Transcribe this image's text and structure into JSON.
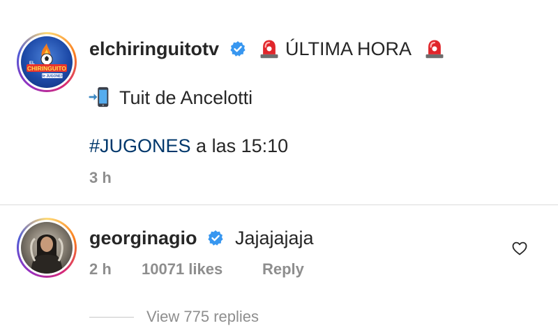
{
  "post": {
    "username": "elchiringuitotv",
    "headline": "ÚLTIMA HORA",
    "line2_text": "Tuit de Ancelotti",
    "hashtag": "#JUGONES",
    "hashtag_suffix": " a las 15:10",
    "time": "3 h",
    "avatar_logo_text": "CHIRINGUITO",
    "avatar_logo_sub": "de JUGONES",
    "avatar_logo_top": "EL"
  },
  "comment": {
    "username": "georginagio",
    "text": "Jajajajaja",
    "time": "2 h",
    "likes": "10071 likes",
    "reply_label": "Reply",
    "view_replies": "View 775 replies"
  },
  "icons": {
    "verified": "verified-badge-icon",
    "siren": "police-siren-emoji",
    "phone": "mobile-phone-arrow-emoji",
    "heart": "heart-outline-icon"
  },
  "colors": {
    "verified_blue": "#3897f0",
    "hashtag": "#00376b",
    "meta_gray": "#8e8e8e"
  }
}
